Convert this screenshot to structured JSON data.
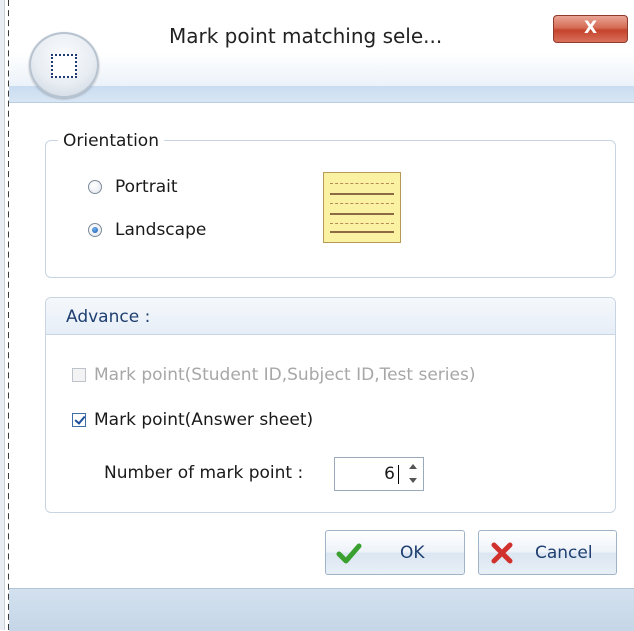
{
  "window": {
    "title": "Mark point matching sele...",
    "close_glyph": "X"
  },
  "orientation": {
    "legend": "Orientation",
    "options": [
      {
        "label": "Portrait",
        "selected": false
      },
      {
        "label": "Landscape",
        "selected": true
      }
    ],
    "preview_icon": "landscape-paper-icon"
  },
  "advance": {
    "title": "Advance :",
    "checkboxes": [
      {
        "label": "Mark point(Student ID,Subject ID,Test series)",
        "checked": false,
        "enabled": false
      },
      {
        "label": "Mark point(Answer sheet)",
        "checked": true,
        "enabled": true
      }
    ],
    "mark_count_label": "Number of mark point :",
    "mark_count_value": "6"
  },
  "buttons": {
    "ok_label": "OK",
    "cancel_label": "Cancel",
    "ok_icon": "checkmark-icon",
    "cancel_icon": "red-x-icon"
  },
  "colors": {
    "accent": "#1e3f70",
    "ok_green": "#3aa02f",
    "cancel_red": "#d0312d",
    "close_red": "#c5432c"
  }
}
